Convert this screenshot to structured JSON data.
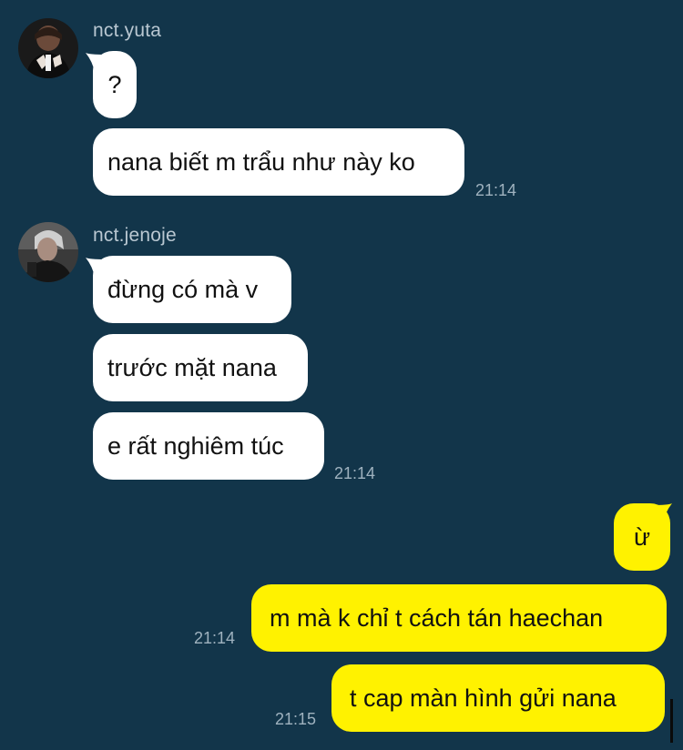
{
  "conversation": {
    "groups": [
      {
        "sender": "nct.yuta",
        "messages": [
          "?",
          "nana biết m trẩu như này ko"
        ],
        "time": "21:14"
      },
      {
        "sender": "nct.jenoje",
        "messages": [
          "đừng có mà v",
          "trước mặt nana",
          "e rất nghiêm túc"
        ],
        "time": "21:14"
      }
    ],
    "outgoing": [
      {
        "text": "ừ",
        "time": ""
      },
      {
        "text": "m mà k chỉ t cách tán haechan",
        "time": "21:14"
      },
      {
        "text": "t cap màn hình gửi nana",
        "time": "21:15"
      }
    ]
  },
  "colors": {
    "background": "#12354a",
    "incoming_bubble": "#ffffff",
    "outgoing_bubble": "#fff200",
    "sender_text": "#b9c7d1",
    "timestamp_text": "#9fb2bf"
  },
  "icons": {
    "avatar_1": "profile-photo-avatar",
    "avatar_2": "profile-photo-avatar"
  }
}
